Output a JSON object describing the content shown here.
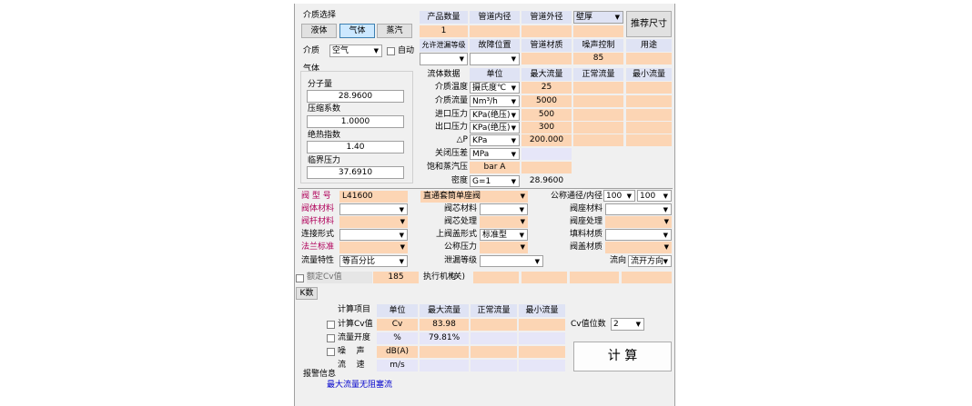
{
  "medium": {
    "group_label": "介质选择",
    "liquid": "液体",
    "gas": "气体",
    "steam": "蒸汽",
    "medium_label": "介质",
    "medium_value": "空气",
    "auto_label": "自动"
  },
  "gas_props": {
    "title": "气体",
    "mw_label": "分子量",
    "mw_value": "28.9600",
    "comp_label": "压缩系数",
    "comp_value": "1.0000",
    "k_label": "绝热指数",
    "k_value": "1.40",
    "pc_label": "临界压力",
    "pc_value": "37.6910"
  },
  "top_table": {
    "headers": [
      "产品数量",
      "管道内径",
      "管道外径",
      "壁厚"
    ],
    "values": [
      "1",
      "",
      "",
      ""
    ],
    "recommend_button": "推荐尺寸",
    "headers2": [
      "允许泄漏等级",
      "故障位置",
      "管道材质",
      "噪声控制",
      "用途"
    ],
    "values2": [
      "",
      "",
      "",
      "85",
      ""
    ]
  },
  "flow": {
    "headers": [
      "流体数据",
      "单位",
      "最大流量",
      "正常流量",
      "最小流量"
    ],
    "rows": [
      {
        "label": "介质温度",
        "unit": "摄氏度℃",
        "max": "25"
      },
      {
        "label": "介质流量",
        "unit": "Nm³/h",
        "max": "5000"
      },
      {
        "label": "进口压力",
        "unit": "KPa(绝压)",
        "max": "500"
      },
      {
        "label": "出口压力",
        "unit": "KPa(绝压)",
        "max": "300"
      },
      {
        "label": "△P",
        "unit": "KPa",
        "max": "200.000"
      },
      {
        "label": "关闭压差",
        "unit": "MPa",
        "max": ""
      },
      {
        "label": "饱和蒸汽压",
        "unit": "bar A",
        "max": ""
      },
      {
        "label": "密度",
        "unit": "G=1",
        "max": "28.9600"
      }
    ]
  },
  "valve": {
    "col1": [
      {
        "label": "阀 型 号",
        "value": "L41600"
      },
      {
        "label": "阀体材料",
        "value": ""
      },
      {
        "label": "阀杆材料",
        "value": ""
      },
      {
        "label": "连接形式",
        "value": ""
      },
      {
        "label": "法兰标准",
        "value": ""
      },
      {
        "label": "流量特性",
        "value": "等百分比"
      }
    ],
    "col2": [
      {
        "label": "",
        "value": "直通套筒单座阀"
      },
      {
        "label": "阀芯材料",
        "value": ""
      },
      {
        "label": "阀芯处理",
        "value": ""
      },
      {
        "label": "上阀盖形式",
        "value": "标准型"
      },
      {
        "label": "公称压力",
        "value": ""
      },
      {
        "label": "泄漏等级",
        "value": ""
      }
    ],
    "col3": [
      {
        "label": "公称通径/内径",
        "value": "100",
        "value2": "100"
      },
      {
        "label": "阀座材料",
        "value": ""
      },
      {
        "label": "阀座处理",
        "value": ""
      },
      {
        "label": "填料材质",
        "value": ""
      },
      {
        "label": "阀盖材质",
        "value": ""
      },
      {
        "label": "流向",
        "value": "流开方向"
      }
    ]
  },
  "rated_cv": {
    "label": "额定Cv值",
    "value": "185",
    "actuator_label": "执行机构",
    "actuator_value": "(关)"
  },
  "k_button": "K数",
  "calc": {
    "headers": [
      "计算项目",
      "单位",
      "最大流量",
      "正常流量",
      "最小流量"
    ],
    "rows": [
      {
        "label": "计算Cv值",
        "unit": "Cv",
        "max": "83.98",
        "check": true
      },
      {
        "label": "流量开度",
        "unit": "%",
        "max": "79.81%",
        "check": true
      },
      {
        "label": "噪    声",
        "unit": "dB(A)",
        "max": "",
        "check": true
      },
      {
        "label": "流    速",
        "unit": "m/s",
        "max": "",
        "check": false
      }
    ],
    "cv_digits_label": "Cv值位数",
    "cv_digits_value": "2",
    "calc_button": "计  算"
  },
  "alarm": {
    "label": "报警信息",
    "message": "最大流量无阻塞流",
    "color": "#0000cc"
  },
  "colors": {
    "input_bg": "#fcd5b4",
    "header_bg": "#dfe3f4",
    "panel_bg": "#f0f0f0"
  }
}
